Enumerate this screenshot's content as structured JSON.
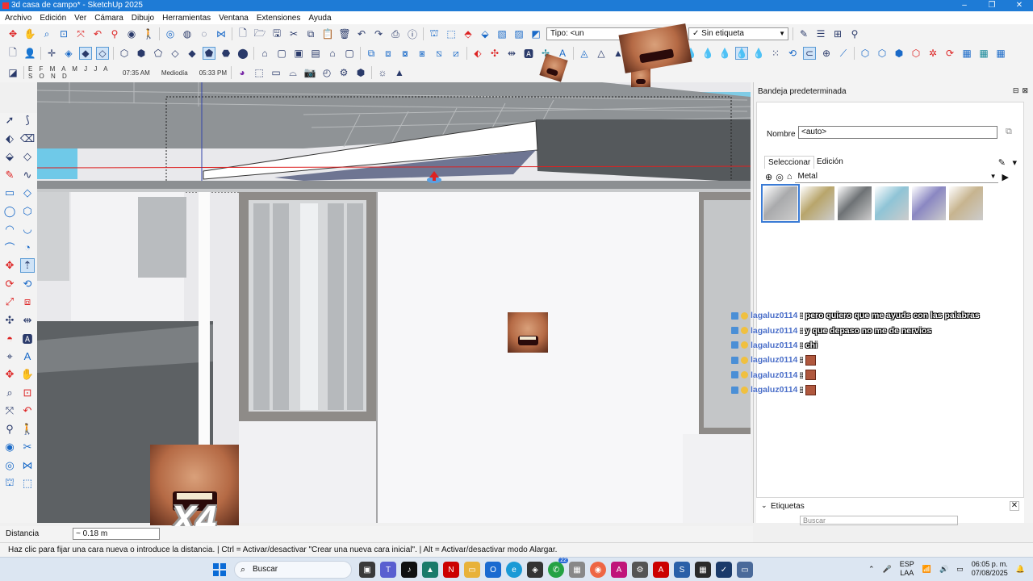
{
  "window": {
    "title": "3d casa de campo* - SketchUp 2025",
    "minimize": "–",
    "maximize": "❐",
    "close": "✕"
  },
  "menu": [
    "Archivo",
    "Edición",
    "Ver",
    "Cámara",
    "Dibujo",
    "Herramientas",
    "Ventana",
    "Extensiones",
    "Ayuda"
  ],
  "toolbar": {
    "tipo_value": "Tipo: <un",
    "tag_value": "Sin etiqueta",
    "months": "E F M A M J J A S O N D",
    "time_start": "07:35 AM",
    "time_mid": "Mediodía",
    "time_end": "05:33 PM"
  },
  "tray": {
    "title": "Bandeja predeterminada",
    "name_label": "Nombre",
    "name_value": "<auto>",
    "tab_select": "Seleccionar",
    "tab_edit": "Edición",
    "library": "Metal",
    "swatch_colors": [
      "#a9aaac",
      "#b8a56b",
      "#6e7275",
      "#8fc4d6",
      "#8a87c2",
      "#c7b48f"
    ],
    "tags_header": "Etiquetas",
    "tags_search_placeholder": "Buscar"
  },
  "chat": [
    {
      "user": "lagaluz0114",
      "msg": ": pero quiero que me ayuds con las palabras",
      "emote": false
    },
    {
      "user": "lagaluz0114",
      "msg": ": y que depaso no me de nervios",
      "emote": false
    },
    {
      "user": "lagaluz0114",
      "msg": ": chi",
      "emote": false
    },
    {
      "user": "lagaluz0114",
      "msg": ":",
      "emote": true
    },
    {
      "user": "lagaluz0114",
      "msg": ":",
      "emote": true
    },
    {
      "user": "lagaluz0114",
      "msg": ":",
      "emote": true
    }
  ],
  "overlay": {
    "multiplier": "X4"
  },
  "measurements": {
    "label": "Distancia",
    "value": "~ 0.18 m"
  },
  "status": "Haz clic para fijar una cara nueva o introduce la distancia. | Ctrl = Activar/desactivar \"Crear una nueva cara inicial\". | Alt = Activar/desactivar modo Alargar.",
  "taskbar": {
    "search_placeholder": "Buscar",
    "badge_count": "22",
    "language": "ESP",
    "language_sub": "LAA",
    "time": "06:05 p. m.",
    "date": "07/08/2025"
  }
}
